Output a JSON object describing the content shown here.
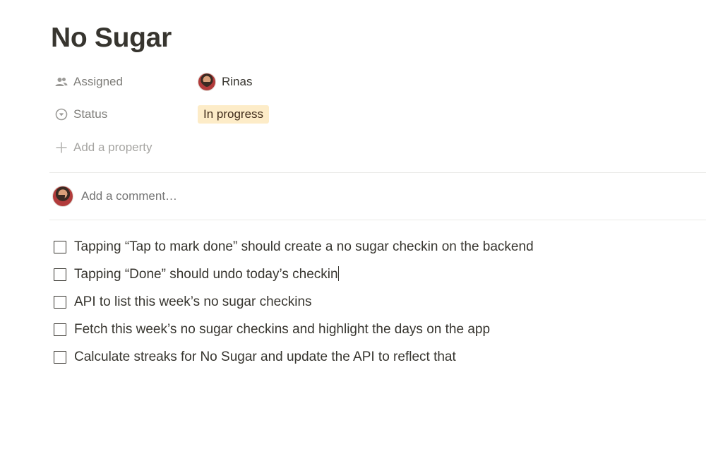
{
  "page": {
    "title": "No Sugar"
  },
  "properties": [
    {
      "label": "Assigned",
      "icon": "people-icon",
      "value": "Rinas"
    },
    {
      "label": "Status",
      "icon": "status-icon",
      "value": "In progress"
    }
  ],
  "add_property_label": "Add a property",
  "comment": {
    "placeholder": "Add a comment…"
  },
  "todos": [
    {
      "text": "Tapping “Tap to mark done” should create a no sugar checkin on the backend",
      "checked": false
    },
    {
      "text": "Tapping “Done” should undo today’s checkin",
      "checked": false
    },
    {
      "text": "API to list this week’s no sugar checkins",
      "checked": false
    },
    {
      "text": "Fetch this week’s no sugar checkins and highlight the days on the app",
      "checked": false
    },
    {
      "text": "Calculate streaks for No Sugar and update the API to reflect that",
      "checked": false
    }
  ],
  "colors": {
    "text": "#37352f",
    "status_badge_bg": "#fdecc8",
    "divider": "#e9e9e7"
  }
}
